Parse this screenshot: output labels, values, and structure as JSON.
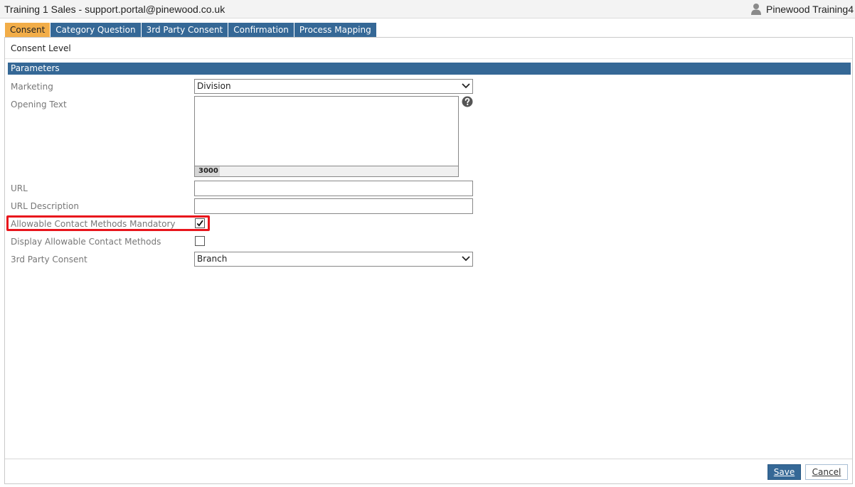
{
  "header": {
    "title": "Training 1 Sales - support.portal@pinewood.co.uk",
    "user_icon": "user-icon",
    "user_name": "Pinewood Training4"
  },
  "tabs": [
    {
      "label": "Consent",
      "active": true
    },
    {
      "label": "Category Question",
      "active": false
    },
    {
      "label": "3rd Party Consent",
      "active": false
    },
    {
      "label": "Confirmation",
      "active": false
    },
    {
      "label": "Process Mapping",
      "active": false
    }
  ],
  "panel": {
    "title": "Consent Level",
    "section": "Parameters"
  },
  "fields": {
    "marketing": {
      "label": "Marketing",
      "value": "Division"
    },
    "opening_text": {
      "label": "Opening Text",
      "value": "",
      "char_count": "3000",
      "help_icon": "help-icon"
    },
    "url": {
      "label": "URL",
      "value": ""
    },
    "url_description": {
      "label": "URL Description",
      "value": ""
    },
    "allowable_mandatory": {
      "label": "Allowable Contact Methods Mandatory",
      "checked": true
    },
    "display_allowable": {
      "label": "Display Allowable Contact Methods",
      "checked": false
    },
    "third_party": {
      "label": "3rd Party Consent",
      "value": "Branch"
    }
  },
  "footer": {
    "save_label": "Save",
    "cancel_label": "Cancel"
  },
  "colors": {
    "tab_blue": "#356896",
    "tab_active": "#f2ad48",
    "highlight": "#e8151c"
  }
}
